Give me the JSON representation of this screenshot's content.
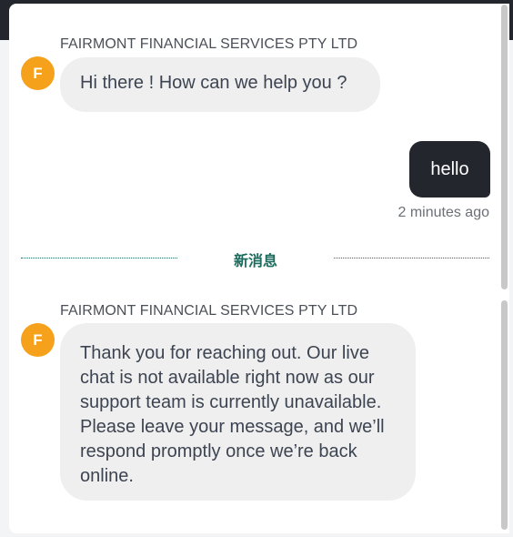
{
  "chat": {
    "messages": [
      {
        "sender": "FAIRMONT FINANCIAL SERVICES PTY LTD",
        "avatar_letter": "F",
        "text": "Hi there ! How can we help you ?"
      },
      {
        "text": "hello",
        "timestamp": "2 minutes ago"
      },
      {
        "sender": "FAIRMONT FINANCIAL SERVICES PTY LTD",
        "avatar_letter": "F",
        "text": "Thank you for reaching out. Our live chat is not available right now as our support team is currently unavailable. Please leave your message, and we’ll respond promptly once we’re back online."
      }
    ],
    "divider_label": "新消息"
  },
  "colors": {
    "avatar": "#f5a11c",
    "agent_bubble": "#efefef",
    "user_bubble": "#23262d",
    "divider": "#1b6b5c"
  }
}
